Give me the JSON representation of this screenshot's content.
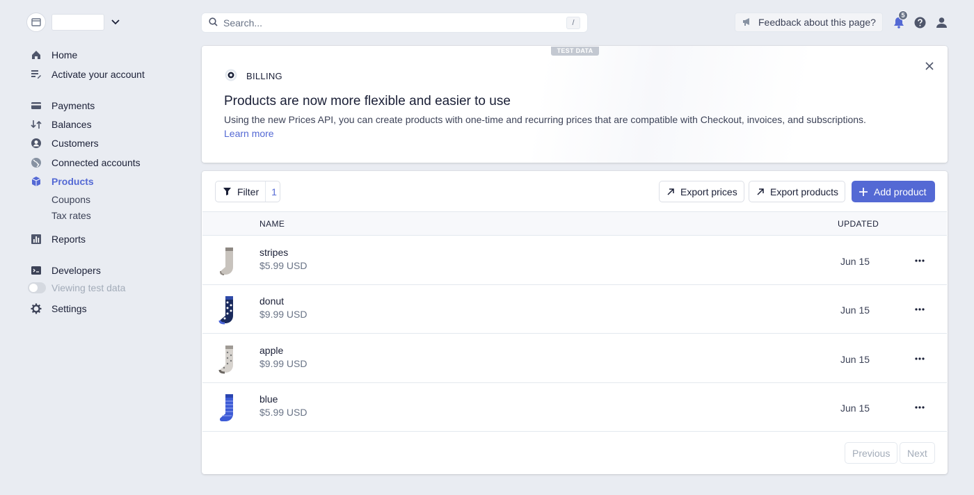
{
  "account": {
    "name": ""
  },
  "sidebar": {
    "items": [
      {
        "label": "Home",
        "icon": "home-icon"
      },
      {
        "label": "Activate your account",
        "icon": "activate-icon"
      },
      {
        "label": "Payments",
        "icon": "payments-icon"
      },
      {
        "label": "Balances",
        "icon": "balances-icon"
      },
      {
        "label": "Customers",
        "icon": "customers-icon"
      },
      {
        "label": "Connected accounts",
        "icon": "globe-icon"
      },
      {
        "label": "Products",
        "icon": "products-icon",
        "active": true
      },
      {
        "label": "Reports",
        "icon": "reports-icon"
      },
      {
        "label": "Developers",
        "icon": "developers-icon"
      },
      {
        "label": "Settings",
        "icon": "gear-icon"
      }
    ],
    "subitems": [
      {
        "label": "Coupons"
      },
      {
        "label": "Tax rates"
      }
    ],
    "test_toggle_label": "Viewing test data"
  },
  "topbar": {
    "search_placeholder": "Search...",
    "search_shortcut": "/",
    "feedback_label": "Feedback about this page?",
    "notification_count": "5"
  },
  "banner": {
    "tag": "TEST DATA",
    "label": "BILLING",
    "title": "Products are now more flexible and easier to use",
    "description": "Using the new Prices API, you can create products with one-time and recurring prices that are compatible with Checkout, invoices, and subscriptions.",
    "link": "Learn more"
  },
  "products": {
    "filter_label": "Filter",
    "filter_count": "1",
    "export_prices_label": "Export prices",
    "export_products_label": "Export products",
    "add_product_label": "Add product",
    "columns": {
      "name": "NAME",
      "updated": "UPDATED"
    },
    "rows": [
      {
        "name": "stripes",
        "price": "$5.99 USD",
        "updated": "Jun 15"
      },
      {
        "name": "donut",
        "price": "$9.99 USD",
        "updated": "Jun 15"
      },
      {
        "name": "apple",
        "price": "$9.99 USD",
        "updated": "Jun 15"
      },
      {
        "name": "blue",
        "price": "$5.99 USD",
        "updated": "Jun 15"
      }
    ],
    "previous_label": "Previous",
    "next_label": "Next"
  },
  "colors": {
    "accent": "#5469d4",
    "background": "#e9ecf2",
    "text": "#1a1f36",
    "muted": "#697386"
  }
}
